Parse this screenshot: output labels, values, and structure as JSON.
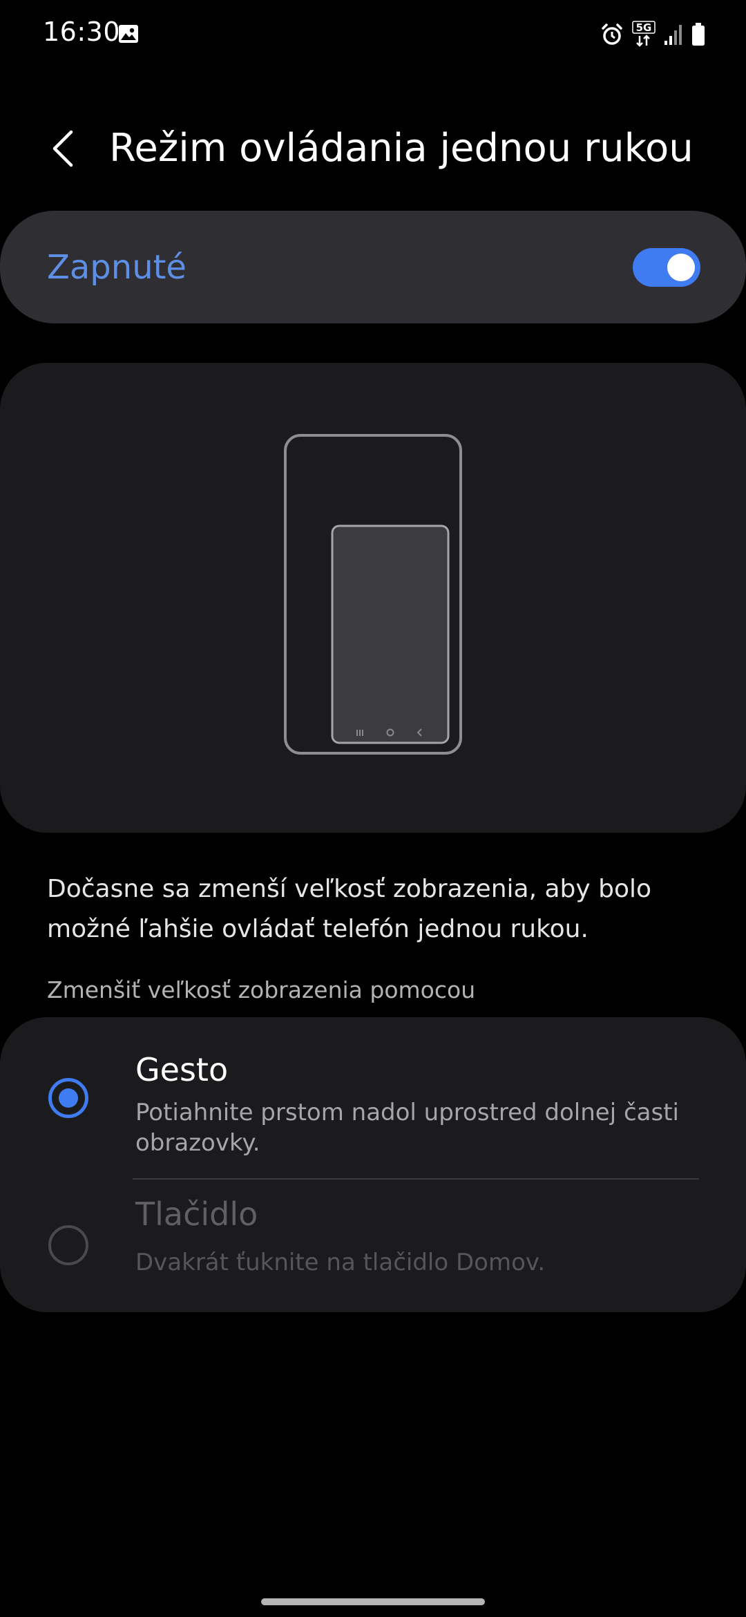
{
  "status_bar": {
    "time": "16:30",
    "icons": [
      "gallery-icon",
      "alarm-icon",
      "5g-icon",
      "signal-icon",
      "battery-icon"
    ],
    "network_label": "5G"
  },
  "header": {
    "back_icon": "chevron-left-icon",
    "title": "Režim ovládania jednou rukou"
  },
  "master_switch": {
    "label": "Zapnuté",
    "state": "on",
    "accent_color": "#3f7cf1",
    "label_color": "#5e8fe6"
  },
  "illustration": {
    "icon": "one-handed-mode-phone-illustration",
    "nav_icons": [
      "recents-icon",
      "home-icon",
      "back-icon"
    ]
  },
  "description": "Dočasne sa zmenší veľkosť zobrazenia, aby bolo možné ľahšie ovládať telefón jednou rukou.",
  "section": {
    "header": "Zmenšiť veľkosť zobrazenia pomocou",
    "options": [
      {
        "title": "Gesto",
        "subtitle": "Potiahnite prstom nadol uprostred dolnej časti obrazovky.",
        "selected": true
      },
      {
        "title": "Tlačidlo",
        "subtitle": "Dvakrát ťuknite na tlačidlo Domov.",
        "selected": false
      }
    ]
  }
}
